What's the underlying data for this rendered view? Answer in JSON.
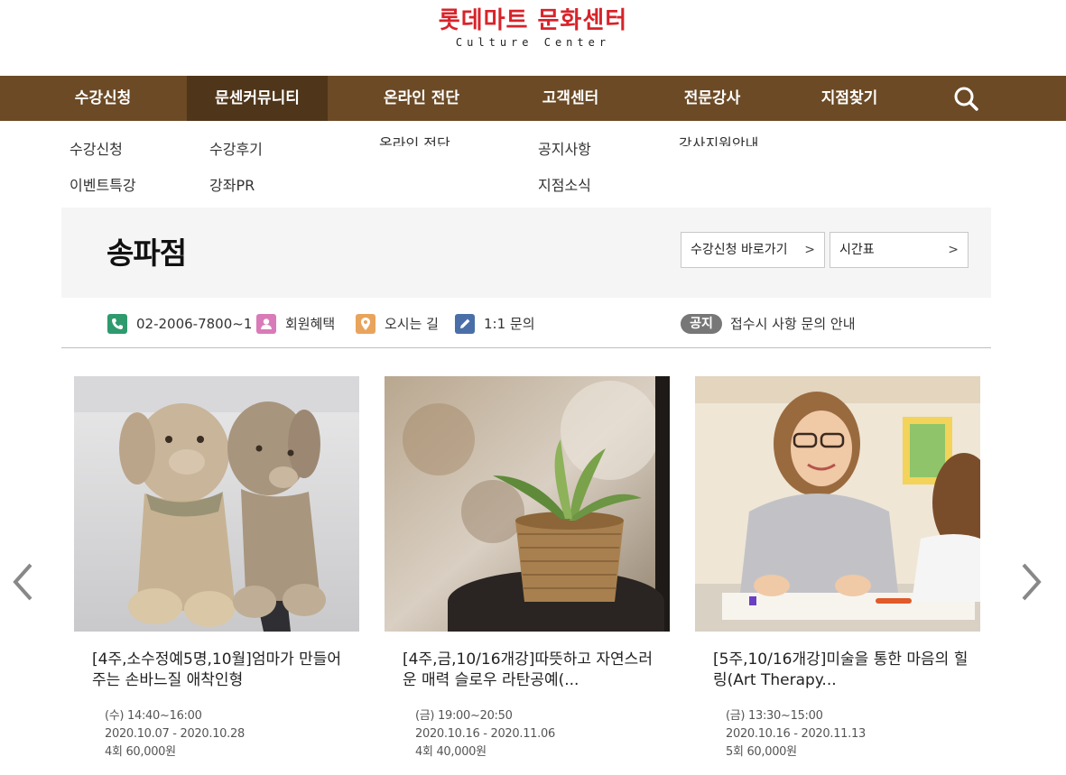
{
  "logo": {
    "korean": "롯데마트 문화센터",
    "english": "Culture Center"
  },
  "gnb": [
    {
      "label": "수강신청"
    },
    {
      "label": "문센커뮤니티"
    },
    {
      "label": "온라인 전단"
    },
    {
      "label": "고객센터"
    },
    {
      "label": "전문강사"
    },
    {
      "label": "지점찾기"
    }
  ],
  "submenu": {
    "col1": [
      "수강신청",
      "이벤트특강"
    ],
    "col2": [
      "수강후기",
      "강좌PR"
    ],
    "col3": [
      "온라인 전단"
    ],
    "col4": [
      "공지사항",
      "지점소식"
    ],
    "col5": [
      "강사지원안내"
    ]
  },
  "branch": {
    "name": "송파점",
    "apply_button": "수강신청 바로가기",
    "timetable_button": "시간표"
  },
  "info": {
    "phone": "02-2006-7800~1",
    "benefits": "회원혜택",
    "directions": "오시는 길",
    "inquiry": "1:1 문의",
    "notice_badge": "공지",
    "notice_text": "접수시 사항 문의 안내"
  },
  "colors": {
    "brand_red": "#d8232a",
    "nav_brown": "#6b4a25",
    "nav_active": "#4f3519",
    "phone_icon": "#2f9a6e",
    "benefit_icon": "#d97bb8",
    "map_icon": "#e8a45c",
    "pencil_icon": "#4a6fa8"
  },
  "courses": [
    {
      "title": "[4주,소수정예5명,10월]엄마가 만들어 주는 손바느질 애착인형",
      "time": "(수) 14:40~16:00",
      "period": "2020.10.07 - 2020.10.28",
      "price": "4회 60,000원",
      "image": "plush-dolls-photo"
    },
    {
      "title": "[4주,금,10/16개강]따뜻하고 자연스러운 매력 슬로우 라탄공예(...",
      "time": "(금) 19:00~20:50",
      "period": "2020.10.16 - 2020.11.06",
      "price": "4회 40,000원",
      "image": "rattan-basket-plant-photo"
    },
    {
      "title": "[5주,10/16개강]미술을 통한 마음의 힐링(Art Therapy...",
      "time": "(금) 13:30~15:00",
      "period": "2020.10.16 - 2020.11.13",
      "price": "5회 60,000원",
      "image": "art-therapy-photo"
    }
  ]
}
